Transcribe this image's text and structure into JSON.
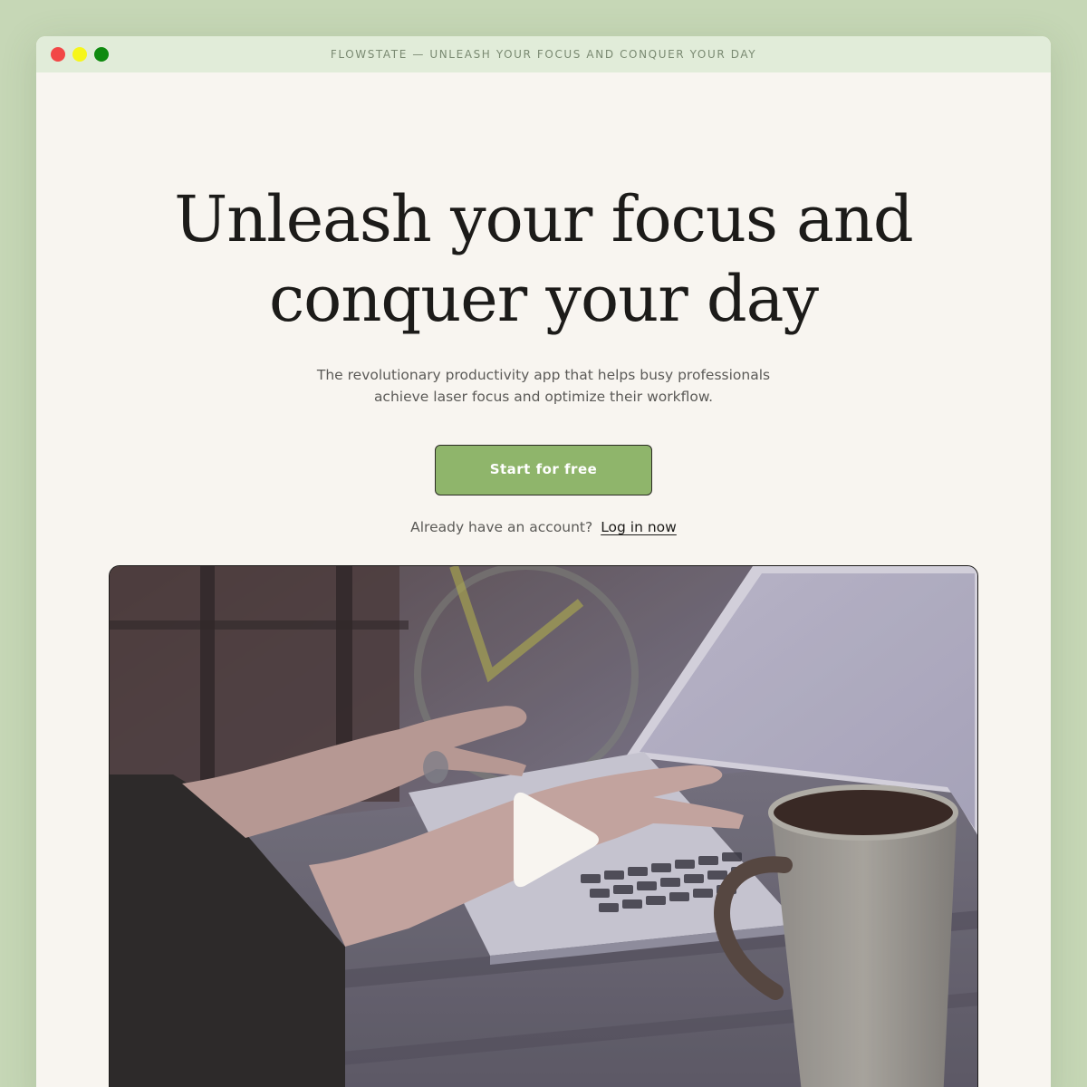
{
  "window": {
    "title": "FLOWSTATE — UNLEASH YOUR FOCUS AND CONQUER YOUR DAY",
    "lights": [
      "close",
      "minimize",
      "maximize"
    ]
  },
  "hero": {
    "headline_line1": "Unleash your focus and",
    "headline_line2": "conquer your day",
    "subtext_line1": "The revolutionary productivity app that helps busy professionals",
    "subtext_line2": "achieve laser focus and optimize their workflow.",
    "cta_label": "Start for free",
    "login_prompt": "Already have an account?",
    "login_link": "Log in now"
  },
  "video": {
    "icon": "play-icon"
  },
  "colors": {
    "background": "#c6d7b6",
    "titlebar": "#e1ecd9",
    "page": "#f8f5f0",
    "accent": "#8fb56b",
    "text": "#1c1b19"
  }
}
